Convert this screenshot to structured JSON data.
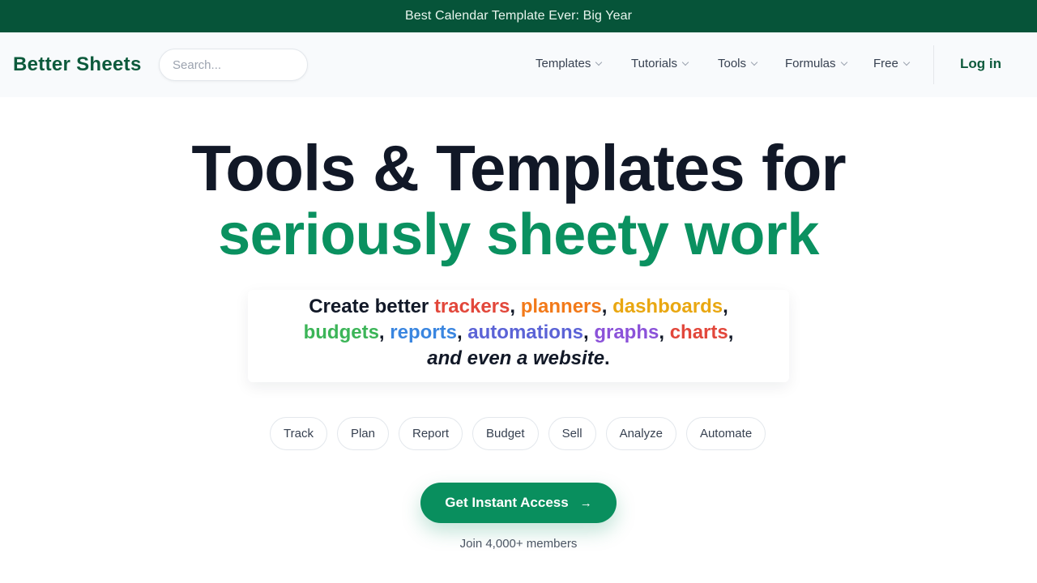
{
  "announcement": "Best Calendar Template Ever: Big Year",
  "brand": "Better Sheets",
  "search": {
    "placeholder": "Search..."
  },
  "nav": {
    "items": [
      "Templates",
      "Tutorials",
      "Tools",
      "Formulas",
      "Free"
    ],
    "login": "Log in"
  },
  "hero": {
    "line1": "Tools & Templates for",
    "line2": "seriously sheety work"
  },
  "subtitle": {
    "prefix": "Create better ",
    "words": [
      "trackers",
      "planners",
      "dashboards",
      "budgets",
      "reports",
      "automations",
      "graphs",
      "charts"
    ],
    "ending": "and even a website",
    "colors": {
      "trackers": "#e2473b",
      "planners": "#f27a1a",
      "dashboards": "#e9a711",
      "budgets": "#3cb558",
      "reports": "#3a86e0",
      "automations": "#5b63d6",
      "graphs": "#8b52d9",
      "charts": "#e2473b"
    }
  },
  "pills": [
    "Track",
    "Plan",
    "Report",
    "Budget",
    "Sell",
    "Analyze",
    "Automate"
  ],
  "cta": {
    "label": "Get Instant Access",
    "icon": "arrow-right-icon"
  },
  "members_text": "Join 4,000+ members",
  "colors": {
    "announcement_bg": "#065439",
    "brand_green": "#0d5a3c",
    "accent_green": "#0a9160"
  }
}
